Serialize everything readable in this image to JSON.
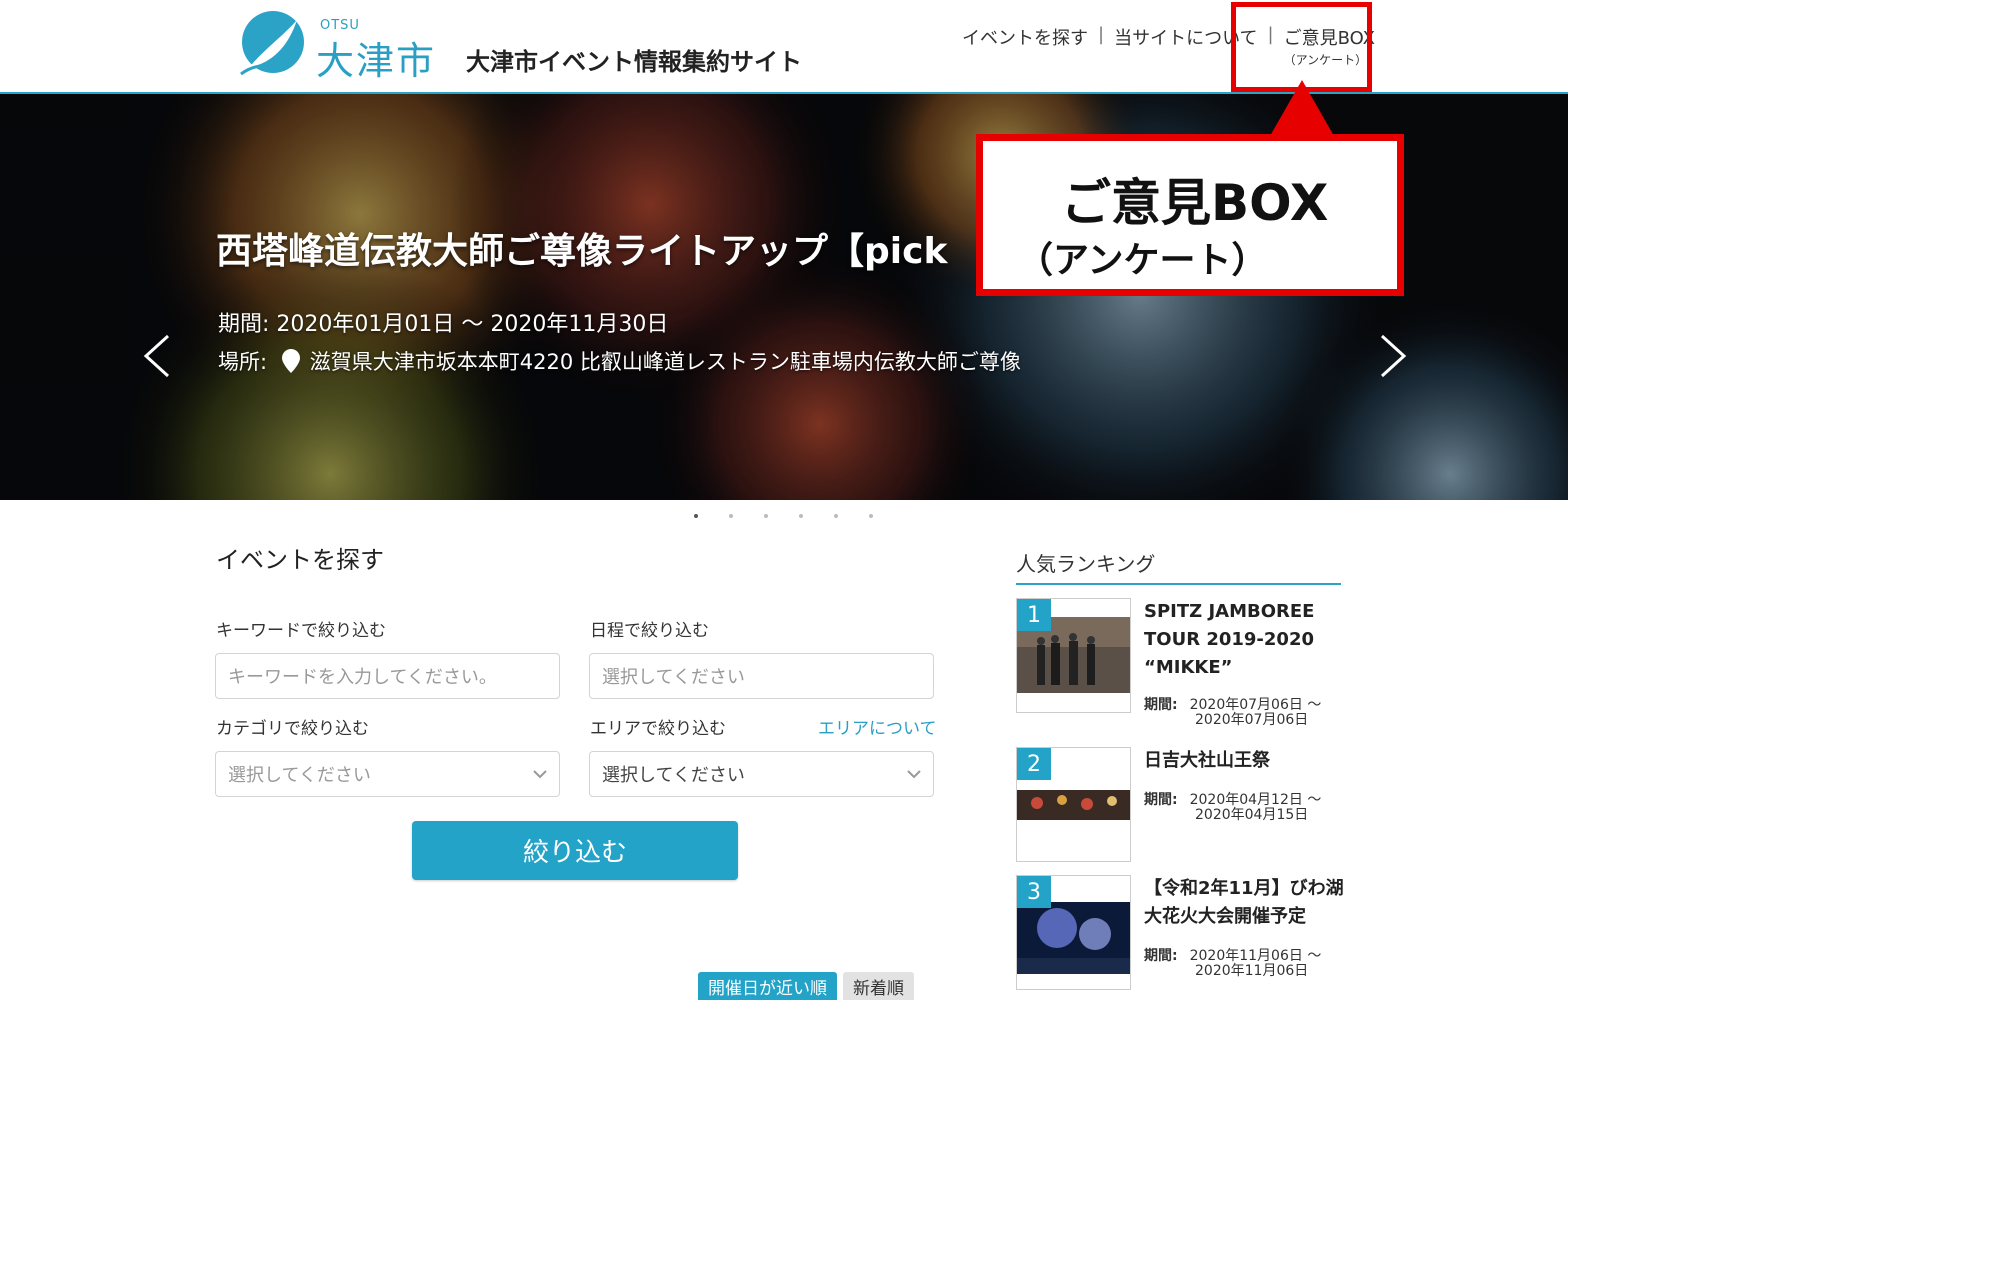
{
  "header": {
    "logo_small": "OTSU",
    "logo_kanji": "大津市",
    "site_title": "大津市イベント情報集約サイト",
    "nav": {
      "find_events": "イベントを探す",
      "separator": "|",
      "about": "当サイトについて",
      "opinion": "ご意見BOX",
      "opinion_sub": "（アンケート）"
    }
  },
  "hero": {
    "title": "西塔峰道伝教大師ご尊像ライトアップ【pick",
    "period_label": "期間: ",
    "period_value": "2020年01月01日 ～ 2020年11月30日",
    "place_label": "場所: ",
    "place_value": "滋賀県大津市坂本本町4220 比叡山峰道レストラン駐車場内伝教大師ご尊像",
    "slide_count": 6,
    "active_slide": 1
  },
  "callout": {
    "main": "ご意見BOX",
    "sub": "（アンケート）",
    "color": "#e60000"
  },
  "search": {
    "heading": "イベントを探す",
    "keyword_label": "キーワードで絞り込む",
    "keyword_placeholder": "キーワードを入力してください。",
    "date_label": "日程で絞り込む",
    "date_placeholder": "選択してください",
    "category_label": "カテゴリで絞り込む",
    "category_value": "選択してください",
    "area_label": "エリアで絞り込む",
    "area_link": "エリアについて",
    "area_value": "選択してください",
    "filter_button": "絞り込む",
    "sort_near": "開催日が近い順",
    "sort_new": "新着順"
  },
  "ranking": {
    "heading": "人気ランキング",
    "period_label": "期間:",
    "items": [
      {
        "rank": "1",
        "title": "SPITZ JAMBOREE TOUR 2019-2020 “MIKKE”",
        "period_start": "2020年07月06日 ～",
        "period_end": "2020年07月06日"
      },
      {
        "rank": "2",
        "title": "日吉大社山王祭",
        "period_start": "2020年04月12日 ～",
        "period_end": "2020年04月15日"
      },
      {
        "rank": "3",
        "title": "【令和2年11月】びわ湖大花火大会開催予定",
        "period_start": "2020年11月06日 ～",
        "period_end": "2020年11月06日"
      }
    ]
  },
  "colors": {
    "accent": "#22a3c7",
    "highlight_red": "#e60000"
  }
}
